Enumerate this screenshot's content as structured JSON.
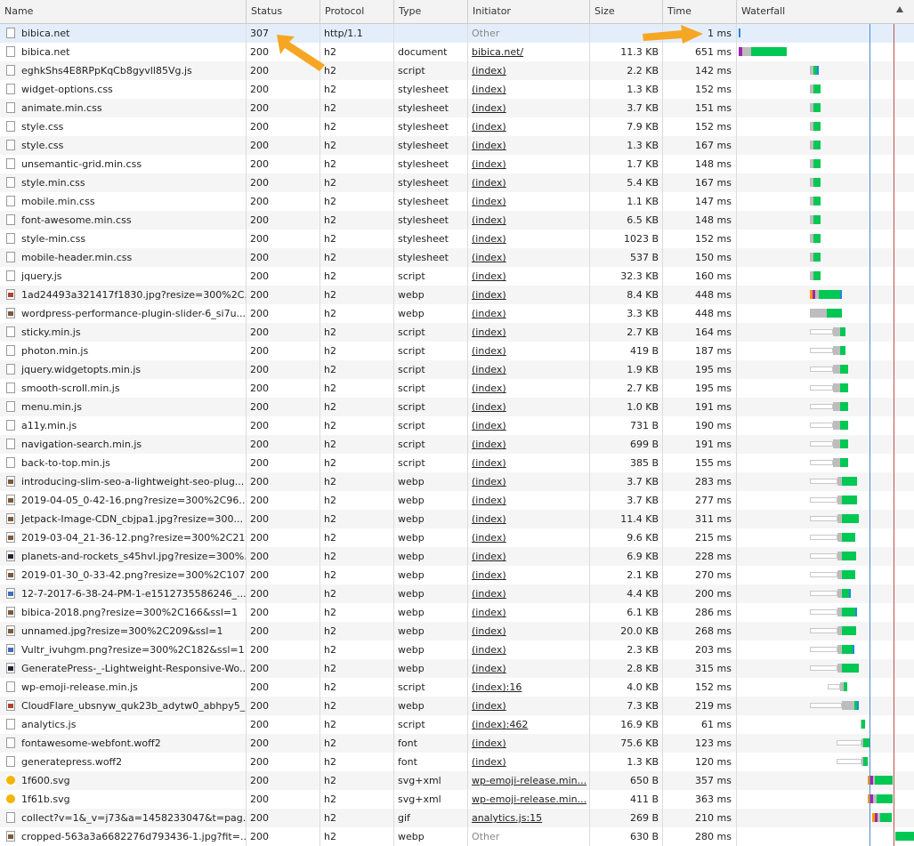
{
  "columns": [
    "Name",
    "Status",
    "Protocol",
    "Type",
    "Initiator",
    "Size",
    "Time",
    "Waterfall"
  ],
  "colors": {
    "ttfb": "#00c853",
    "download": "#1e88e5",
    "queue": "#bdbdbd",
    "dns": "#ff9800",
    "ssl": "#9c27b0",
    "stalled": "#9e9e9e",
    "dcl_line": "#4a8ad0",
    "load_line": "#c0504d",
    "arrow": "#f5a623"
  },
  "rows": [
    {
      "name": "bibica.net",
      "status": "307",
      "protocol": "http/1.1",
      "type": "",
      "initiator": "Other",
      "init_link": false,
      "size": "",
      "time": "1 ms",
      "icon": "doc"
    },
    {
      "name": "bibica.net",
      "status": "200",
      "protocol": "h2",
      "type": "document",
      "initiator": "bibica.net/",
      "init_link": true,
      "size": "11.3 KB",
      "time": "651 ms",
      "icon": "doc"
    },
    {
      "name": "eghkShs4E8RPpKqCb8gyvll85Vg.js",
      "status": "200",
      "protocol": "h2",
      "type": "script",
      "initiator": "(index)",
      "init_link": true,
      "size": "2.2 KB",
      "time": "142 ms",
      "icon": "doc"
    },
    {
      "name": "widget-options.css",
      "status": "200",
      "protocol": "h2",
      "type": "stylesheet",
      "initiator": "(index)",
      "init_link": true,
      "size": "1.3 KB",
      "time": "152 ms",
      "icon": "doc"
    },
    {
      "name": "animate.min.css",
      "status": "200",
      "protocol": "h2",
      "type": "stylesheet",
      "initiator": "(index)",
      "init_link": true,
      "size": "3.7 KB",
      "time": "151 ms",
      "icon": "doc"
    },
    {
      "name": "style.css",
      "status": "200",
      "protocol": "h2",
      "type": "stylesheet",
      "initiator": "(index)",
      "init_link": true,
      "size": "7.9 KB",
      "time": "152 ms",
      "icon": "doc"
    },
    {
      "name": "style.css",
      "status": "200",
      "protocol": "h2",
      "type": "stylesheet",
      "initiator": "(index)",
      "init_link": true,
      "size": "1.3 KB",
      "time": "167 ms",
      "icon": "doc"
    },
    {
      "name": "unsemantic-grid.min.css",
      "status": "200",
      "protocol": "h2",
      "type": "stylesheet",
      "initiator": "(index)",
      "init_link": true,
      "size": "1.7 KB",
      "time": "148 ms",
      "icon": "doc"
    },
    {
      "name": "style.min.css",
      "status": "200",
      "protocol": "h2",
      "type": "stylesheet",
      "initiator": "(index)",
      "init_link": true,
      "size": "5.4 KB",
      "time": "167 ms",
      "icon": "doc"
    },
    {
      "name": "mobile.min.css",
      "status": "200",
      "protocol": "h2",
      "type": "stylesheet",
      "initiator": "(index)",
      "init_link": true,
      "size": "1.1 KB",
      "time": "147 ms",
      "icon": "doc"
    },
    {
      "name": "font-awesome.min.css",
      "status": "200",
      "protocol": "h2",
      "type": "stylesheet",
      "initiator": "(index)",
      "init_link": true,
      "size": "6.5 KB",
      "time": "148 ms",
      "icon": "doc"
    },
    {
      "name": "style-min.css",
      "status": "200",
      "protocol": "h2",
      "type": "stylesheet",
      "initiator": "(index)",
      "init_link": true,
      "size": "1023 B",
      "time": "152 ms",
      "icon": "doc"
    },
    {
      "name": "mobile-header.min.css",
      "status": "200",
      "protocol": "h2",
      "type": "stylesheet",
      "initiator": "(index)",
      "init_link": true,
      "size": "537 B",
      "time": "150 ms",
      "icon": "doc"
    },
    {
      "name": "jquery.js",
      "status": "200",
      "protocol": "h2",
      "type": "script",
      "initiator": "(index)",
      "init_link": true,
      "size": "32.3 KB",
      "time": "160 ms",
      "icon": "doc"
    },
    {
      "name": "1ad24493a321417f1830.jpg?resize=300%2C...",
      "status": "200",
      "protocol": "h2",
      "type": "webp",
      "initiator": "(index)",
      "init_link": true,
      "size": "8.4 KB",
      "time": "448 ms",
      "icon": "img-red"
    },
    {
      "name": "wordpress-performance-plugin-slider-6_si7u...",
      "status": "200",
      "protocol": "h2",
      "type": "webp",
      "initiator": "(index)",
      "init_link": true,
      "size": "3.3 KB",
      "time": "448 ms",
      "icon": "img"
    },
    {
      "name": "sticky.min.js",
      "status": "200",
      "protocol": "h2",
      "type": "script",
      "initiator": "(index)",
      "init_link": true,
      "size": "2.7 KB",
      "time": "164 ms",
      "icon": "doc"
    },
    {
      "name": "photon.min.js",
      "status": "200",
      "protocol": "h2",
      "type": "script",
      "initiator": "(index)",
      "init_link": true,
      "size": "419 B",
      "time": "187 ms",
      "icon": "doc"
    },
    {
      "name": "jquery.widgetopts.min.js",
      "status": "200",
      "protocol": "h2",
      "type": "script",
      "initiator": "(index)",
      "init_link": true,
      "size": "1.9 KB",
      "time": "195 ms",
      "icon": "doc"
    },
    {
      "name": "smooth-scroll.min.js",
      "status": "200",
      "protocol": "h2",
      "type": "script",
      "initiator": "(index)",
      "init_link": true,
      "size": "2.7 KB",
      "time": "195 ms",
      "icon": "doc"
    },
    {
      "name": "menu.min.js",
      "status": "200",
      "protocol": "h2",
      "type": "script",
      "initiator": "(index)",
      "init_link": true,
      "size": "1.0 KB",
      "time": "191 ms",
      "icon": "doc"
    },
    {
      "name": "a11y.min.js",
      "status": "200",
      "protocol": "h2",
      "type": "script",
      "initiator": "(index)",
      "init_link": true,
      "size": "731 B",
      "time": "190 ms",
      "icon": "doc"
    },
    {
      "name": "navigation-search.min.js",
      "status": "200",
      "protocol": "h2",
      "type": "script",
      "initiator": "(index)",
      "init_link": true,
      "size": "699 B",
      "time": "191 ms",
      "icon": "doc"
    },
    {
      "name": "back-to-top.min.js",
      "status": "200",
      "protocol": "h2",
      "type": "script",
      "initiator": "(index)",
      "init_link": true,
      "size": "385 B",
      "time": "155 ms",
      "icon": "doc"
    },
    {
      "name": "introducing-slim-seo-a-lightweight-seo-plug...",
      "status": "200",
      "protocol": "h2",
      "type": "webp",
      "initiator": "(index)",
      "init_link": true,
      "size": "3.7 KB",
      "time": "283 ms",
      "icon": "img"
    },
    {
      "name": "2019-04-05_0-42-16.png?resize=300%2C96...",
      "status": "200",
      "protocol": "h2",
      "type": "webp",
      "initiator": "(index)",
      "init_link": true,
      "size": "3.7 KB",
      "time": "277 ms",
      "icon": "img"
    },
    {
      "name": "Jetpack-Image-CDN_cbjpa1.jpg?resize=300...",
      "status": "200",
      "protocol": "h2",
      "type": "webp",
      "initiator": "(index)",
      "init_link": true,
      "size": "11.4 KB",
      "time": "311 ms",
      "icon": "img"
    },
    {
      "name": "2019-03-04_21-36-12.png?resize=300%2C21...",
      "status": "200",
      "protocol": "h2",
      "type": "webp",
      "initiator": "(index)",
      "init_link": true,
      "size": "9.6 KB",
      "time": "215 ms",
      "icon": "img"
    },
    {
      "name": "planets-and-rockets_s45hvl.jpg?resize=300%...",
      "status": "200",
      "protocol": "h2",
      "type": "webp",
      "initiator": "(index)",
      "init_link": true,
      "size": "6.9 KB",
      "time": "228 ms",
      "icon": "img-dark"
    },
    {
      "name": "2019-01-30_0-33-42.png?resize=300%2C107...",
      "status": "200",
      "protocol": "h2",
      "type": "webp",
      "initiator": "(index)",
      "init_link": true,
      "size": "2.1 KB",
      "time": "270 ms",
      "icon": "img"
    },
    {
      "name": "12-7-2017-6-38-24-PM-1-e1512735586246_...",
      "status": "200",
      "protocol": "h2",
      "type": "webp",
      "initiator": "(index)",
      "init_link": true,
      "size": "4.4 KB",
      "time": "200 ms",
      "icon": "img-blue"
    },
    {
      "name": "bibica-2018.png?resize=300%2C166&ssl=1",
      "status": "200",
      "protocol": "h2",
      "type": "webp",
      "initiator": "(index)",
      "init_link": true,
      "size": "6.1 KB",
      "time": "286 ms",
      "icon": "img"
    },
    {
      "name": "unnamed.jpg?resize=300%2C209&ssl=1",
      "status": "200",
      "protocol": "h2",
      "type": "webp",
      "initiator": "(index)",
      "init_link": true,
      "size": "20.0 KB",
      "time": "268 ms",
      "icon": "img"
    },
    {
      "name": "Vultr_ivuhgm.png?resize=300%2C182&ssl=1",
      "status": "200",
      "protocol": "h2",
      "type": "webp",
      "initiator": "(index)",
      "init_link": true,
      "size": "2.3 KB",
      "time": "203 ms",
      "icon": "img-blue"
    },
    {
      "name": "GeneratePress-_-Lightweight-Responsive-Wo...",
      "status": "200",
      "protocol": "h2",
      "type": "webp",
      "initiator": "(index)",
      "init_link": true,
      "size": "2.8 KB",
      "time": "315 ms",
      "icon": "img-dark"
    },
    {
      "name": "wp-emoji-release.min.js",
      "status": "200",
      "protocol": "h2",
      "type": "script",
      "initiator": "(index):16",
      "init_link": true,
      "size": "4.0 KB",
      "time": "152 ms",
      "icon": "doc"
    },
    {
      "name": "CloudFlare_ubsnyw_quk23b_adytw0_abhpy5_...",
      "status": "200",
      "protocol": "h2",
      "type": "webp",
      "initiator": "(index)",
      "init_link": true,
      "size": "7.3 KB",
      "time": "219 ms",
      "icon": "img-red"
    },
    {
      "name": "analytics.js",
      "status": "200",
      "protocol": "h2",
      "type": "script",
      "initiator": "(index):462",
      "init_link": true,
      "size": "16.9 KB",
      "time": "61 ms",
      "icon": "doc"
    },
    {
      "name": "fontawesome-webfont.woff2",
      "status": "200",
      "protocol": "h2",
      "type": "font",
      "initiator": "(index)",
      "init_link": true,
      "size": "75.6 KB",
      "time": "123 ms",
      "icon": "doc"
    },
    {
      "name": "generatepress.woff2",
      "status": "200",
      "protocol": "h2",
      "type": "font",
      "initiator": "(index)",
      "init_link": true,
      "size": "1.3 KB",
      "time": "120 ms",
      "icon": "doc"
    },
    {
      "name": "1f600.svg",
      "status": "200",
      "protocol": "h2",
      "type": "svg+xml",
      "initiator": "wp-emoji-release.min...",
      "init_link": true,
      "size": "650 B",
      "time": "357 ms",
      "icon": "emoji"
    },
    {
      "name": "1f61b.svg",
      "status": "200",
      "protocol": "h2",
      "type": "svg+xml",
      "initiator": "wp-emoji-release.min...",
      "init_link": true,
      "size": "411 B",
      "time": "363 ms",
      "icon": "emoji"
    },
    {
      "name": "collect?v=1&_v=j73&a=1458233047&t=pag...",
      "status": "200",
      "protocol": "h2",
      "type": "gif",
      "initiator": "analytics.js:15",
      "init_link": true,
      "size": "269 B",
      "time": "210 ms",
      "icon": "doc"
    },
    {
      "name": "cropped-563a3a6682276d793436-1.jpg?fit=...",
      "status": "200",
      "protocol": "h2",
      "type": "webp",
      "initiator": "Other",
      "init_link": false,
      "size": "630 B",
      "time": "280 ms",
      "icon": "img"
    }
  ]
}
